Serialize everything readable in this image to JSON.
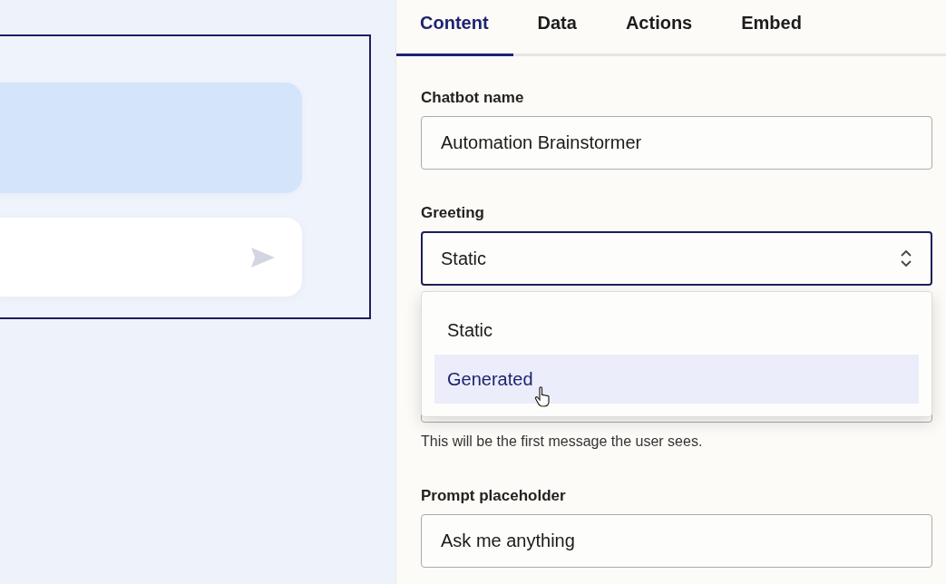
{
  "tabs": [
    {
      "label": "Content",
      "selected": true
    },
    {
      "label": "Data",
      "selected": false
    },
    {
      "label": "Actions",
      "selected": false
    },
    {
      "label": "Embed",
      "selected": false
    }
  ],
  "fields": [
    {
      "kind": "text",
      "label": "Chatbot name",
      "value": "Automation Brainstormer"
    },
    {
      "kind": "select",
      "label": "Greeting",
      "value": "Static",
      "open": true,
      "options": [
        {
          "label": "Static",
          "highlighted": false
        },
        {
          "label": "Generated",
          "highlighted": true
        }
      ],
      "help": "This will be the first message the user sees."
    },
    {
      "kind": "text",
      "label": "Prompt placeholder",
      "value": "Ask me anything"
    }
  ]
}
